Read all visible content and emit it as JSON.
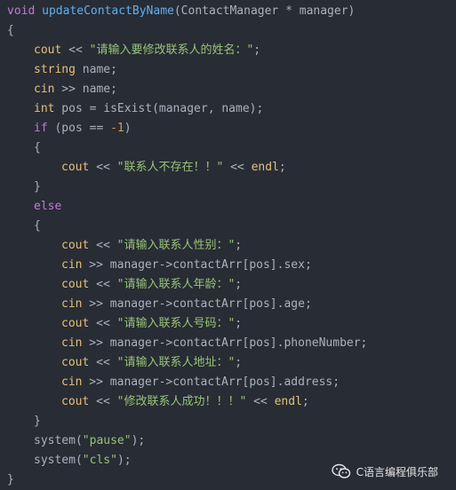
{
  "code": {
    "lines": [
      {
        "indent": 0,
        "tokens": [
          {
            "t": "void",
            "c": "kw"
          },
          {
            "t": " ",
            "c": "id"
          },
          {
            "t": "updateContactByName",
            "c": "fn"
          },
          {
            "t": "(ContactManager * manager)",
            "c": "id"
          }
        ]
      },
      {
        "indent": 0,
        "tokens": [
          {
            "t": "{",
            "c": "punc"
          }
        ]
      },
      {
        "indent": 1,
        "tokens": [
          {
            "t": "cout",
            "c": "io"
          },
          {
            "t": " << ",
            "c": "op"
          },
          {
            "t": "\"请输入要修改联系人的姓名：\"",
            "c": "str"
          },
          {
            "t": ";",
            "c": "punc"
          }
        ]
      },
      {
        "indent": 1,
        "tokens": [
          {
            "t": "string",
            "c": "type"
          },
          {
            "t": " name;",
            "c": "id"
          }
        ]
      },
      {
        "indent": 1,
        "tokens": [
          {
            "t": "cin",
            "c": "io"
          },
          {
            "t": " >> name;",
            "c": "id"
          }
        ]
      },
      {
        "indent": 1,
        "tokens": [
          {
            "t": "int",
            "c": "type"
          },
          {
            "t": " pos = ",
            "c": "id"
          },
          {
            "t": "isExist",
            "c": "id"
          },
          {
            "t": "(manager, name);",
            "c": "id"
          }
        ]
      },
      {
        "indent": 1,
        "tokens": [
          {
            "t": "if",
            "c": "kw"
          },
          {
            "t": " (pos == ",
            "c": "id"
          },
          {
            "t": "-1",
            "c": "num"
          },
          {
            "t": ")",
            "c": "punc"
          }
        ]
      },
      {
        "indent": 1,
        "tokens": [
          {
            "t": "{",
            "c": "punc"
          }
        ]
      },
      {
        "indent": 2,
        "tokens": [
          {
            "t": "cout",
            "c": "io"
          },
          {
            "t": " << ",
            "c": "op"
          },
          {
            "t": "\"联系人不存在！！\"",
            "c": "str"
          },
          {
            "t": " << ",
            "c": "op"
          },
          {
            "t": "endl",
            "c": "io"
          },
          {
            "t": ";",
            "c": "punc"
          }
        ]
      },
      {
        "indent": 1,
        "tokens": [
          {
            "t": "}",
            "c": "punc"
          }
        ]
      },
      {
        "indent": 1,
        "tokens": [
          {
            "t": "else",
            "c": "kw"
          }
        ]
      },
      {
        "indent": 1,
        "tokens": [
          {
            "t": "{",
            "c": "punc"
          }
        ]
      },
      {
        "indent": 2,
        "tokens": [
          {
            "t": "cout",
            "c": "io"
          },
          {
            "t": " << ",
            "c": "op"
          },
          {
            "t": "\"请输入联系人性别：\"",
            "c": "str"
          },
          {
            "t": ";",
            "c": "punc"
          }
        ]
      },
      {
        "indent": 2,
        "tokens": [
          {
            "t": "cin",
            "c": "io"
          },
          {
            "t": " >> manager->contactArr[pos].sex;",
            "c": "id"
          }
        ]
      },
      {
        "indent": 2,
        "tokens": [
          {
            "t": "cout",
            "c": "io"
          },
          {
            "t": " << ",
            "c": "op"
          },
          {
            "t": "\"请输入联系人年龄：\"",
            "c": "str"
          },
          {
            "t": ";",
            "c": "punc"
          }
        ]
      },
      {
        "indent": 2,
        "tokens": [
          {
            "t": "cin",
            "c": "io"
          },
          {
            "t": " >> manager->contactArr[pos].age;",
            "c": "id"
          }
        ]
      },
      {
        "indent": 2,
        "tokens": [
          {
            "t": "cout",
            "c": "io"
          },
          {
            "t": " << ",
            "c": "op"
          },
          {
            "t": "\"请输入联系人号码：\"",
            "c": "str"
          },
          {
            "t": ";",
            "c": "punc"
          }
        ]
      },
      {
        "indent": 2,
        "tokens": [
          {
            "t": "cin",
            "c": "io"
          },
          {
            "t": " >> manager->contactArr[pos].phoneNumber;",
            "c": "id"
          }
        ]
      },
      {
        "indent": 2,
        "tokens": [
          {
            "t": "cout",
            "c": "io"
          },
          {
            "t": " << ",
            "c": "op"
          },
          {
            "t": "\"请输入联系人地址：\"",
            "c": "str"
          },
          {
            "t": ";",
            "c": "punc"
          }
        ]
      },
      {
        "indent": 2,
        "tokens": [
          {
            "t": "cin",
            "c": "io"
          },
          {
            "t": " >> manager->contactArr[pos].address;",
            "c": "id"
          }
        ]
      },
      {
        "indent": 2,
        "tokens": [
          {
            "t": "cout",
            "c": "io"
          },
          {
            "t": " << ",
            "c": "op"
          },
          {
            "t": "\"修改联系人成功！！！\"",
            "c": "str"
          },
          {
            "t": " << ",
            "c": "op"
          },
          {
            "t": "endl",
            "c": "io"
          },
          {
            "t": ";",
            "c": "punc"
          }
        ]
      },
      {
        "indent": 1,
        "tokens": [
          {
            "t": "}",
            "c": "punc"
          }
        ]
      },
      {
        "indent": 1,
        "tokens": [
          {
            "t": "system",
            "c": "id"
          },
          {
            "t": "(",
            "c": "punc"
          },
          {
            "t": "\"pause\"",
            "c": "str"
          },
          {
            "t": ");",
            "c": "punc"
          }
        ]
      },
      {
        "indent": 1,
        "tokens": [
          {
            "t": "system",
            "c": "id"
          },
          {
            "t": "(",
            "c": "punc"
          },
          {
            "t": "\"cls\"",
            "c": "str"
          },
          {
            "t": ");",
            "c": "punc"
          }
        ]
      },
      {
        "indent": 0,
        "tokens": [
          {
            "t": "}",
            "c": "punc"
          }
        ]
      }
    ]
  },
  "watermark": {
    "icon": "wechat-icon",
    "text": "C语言编程俱乐部"
  },
  "colors": {
    "background": "#282c34",
    "keyword": "#c678dd",
    "type": "#e5c07b",
    "function": "#61afef",
    "string": "#98c379",
    "number": "#d19a66",
    "text": "#abb2bf"
  }
}
